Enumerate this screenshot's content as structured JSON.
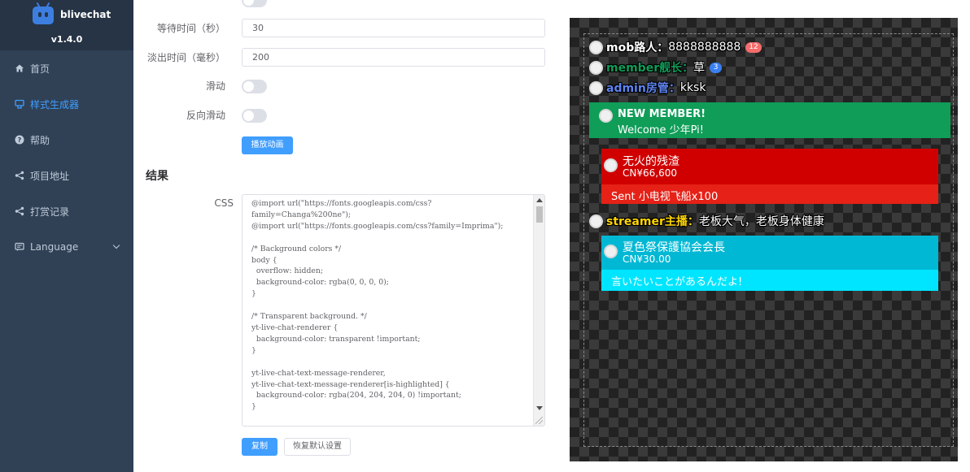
{
  "sidebar": {
    "app_name": "blivechat",
    "version": "v1.4.0",
    "items": [
      {
        "label": "首页",
        "icon": "home-icon",
        "active": false
      },
      {
        "label": "样式生成器",
        "icon": "style-generator-icon",
        "active": true
      },
      {
        "label": "帮助",
        "icon": "help-icon",
        "active": false
      },
      {
        "label": "项目地址",
        "icon": "share-icon",
        "active": false
      },
      {
        "label": "打赏记录",
        "icon": "share-icon",
        "active": false
      },
      {
        "label": "Language",
        "icon": "chat-icon",
        "active": false
      }
    ]
  },
  "form": {
    "wait_time_label": "等待时间（秒）",
    "wait_time_value": "30",
    "fade_time_label": "淡出时间（毫秒）",
    "fade_time_value": "200",
    "slide_label": "滑动",
    "slide_on": false,
    "reverse_slide_label": "反向滑动",
    "reverse_slide_on": false,
    "play_animation_label": "播放动画"
  },
  "result": {
    "title": "结果",
    "css_label": "CSS",
    "css_code": "@import url(\"https://fonts.googleapis.com/css?\nfamily=Changa%200ne\");\n@import url(\"https://fonts.googleapis.com/css?family=Imprima\");\n\n/* Background colors */\nbody {\n  overflow: hidden;\n  background-color: rgba(0, 0, 0, 0);\n}\n\n/* Transparent background. */\nyt-live-chat-renderer {\n  background-color: transparent !important;\n}\n\nyt-live-chat-text-message-renderer,\nyt-live-chat-text-message-renderer[is-highlighted] {\n  background-color: rgba(204, 204, 204, 0) !important;\n}\n",
    "copy_label": "复制",
    "reset_label": "恢复默认设置"
  },
  "preview": {
    "messages": [
      {
        "author": "mob路人：",
        "text": "8888888888",
        "author_color": "#ffffff",
        "badge": "12",
        "badge_color": "#f56c6c"
      },
      {
        "author": "member舰长：",
        "text": "草",
        "author_color": "#0f9d58",
        "badge": "3",
        "badge_color": "#3a7ff0"
      },
      {
        "author": "admin房管：",
        "text": "kksk",
        "author_color": "#5e84f1",
        "badge": null,
        "badge_color": null
      },
      {
        "author": "streamer主播：",
        "text": "老板大气，老板身体健康",
        "author_color": "#ffd600",
        "badge": null,
        "badge_color": null
      }
    ],
    "new_member": {
      "title": "NEW MEMBER!",
      "text": "Welcome 少年Pi!",
      "color": "#0f9d58"
    },
    "gift": {
      "name": "无火的残渣",
      "amount": "CN¥66,600",
      "message": "Sent 小电视飞船x100",
      "header_color": "#d00000",
      "body_color": "#e62117"
    },
    "superchat": {
      "name": "夏色祭保護協会会長",
      "amount": "CN¥30.00",
      "message": "言いたいことがあるんだよ!",
      "header_color": "#00b8d4",
      "body_color": "#00e5ff"
    }
  }
}
